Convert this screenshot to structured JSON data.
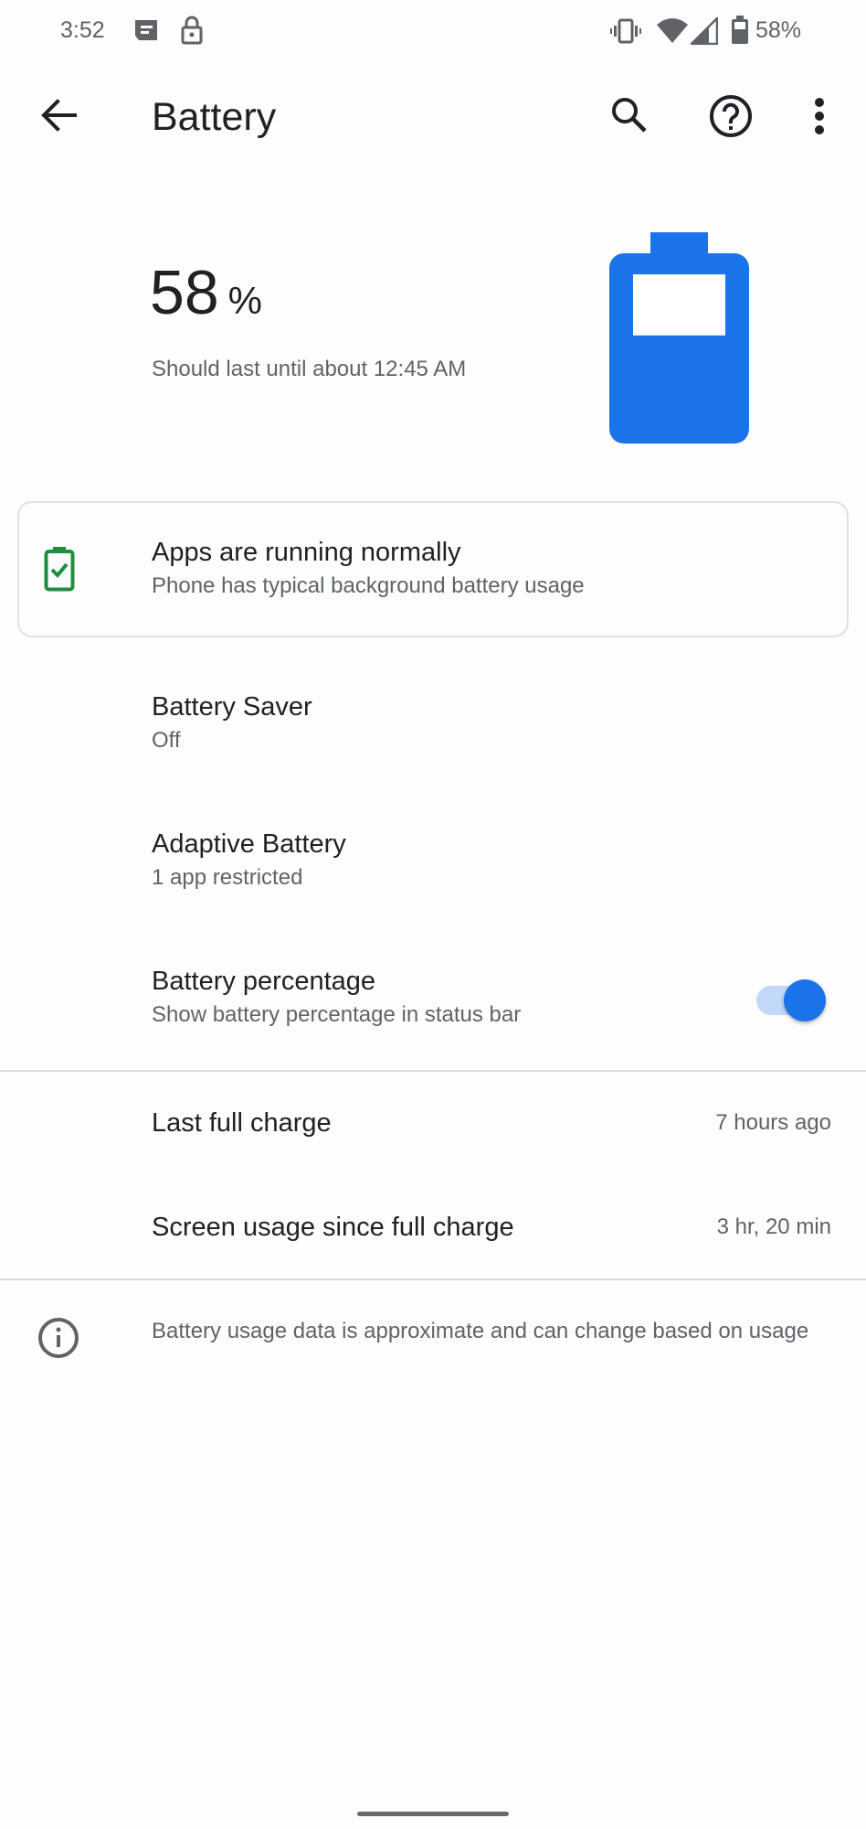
{
  "status_bar": {
    "time": "3:52",
    "left_icons": [
      "messages-notification-icon",
      "lock-icon"
    ],
    "right_icons": [
      "vibrate-icon",
      "wifi-icon",
      "cell-signal-icon",
      "battery-icon"
    ],
    "battery_percent_text": "58%"
  },
  "toolbar": {
    "back_icon": "arrow-back-icon",
    "title": "Battery",
    "actions": [
      {
        "name": "search",
        "icon": "search-icon"
      },
      {
        "name": "help",
        "icon": "help-icon"
      },
      {
        "name": "more",
        "icon": "more-vert-icon"
      }
    ]
  },
  "header": {
    "percent_value": "58",
    "percent_unit": "%",
    "level_fraction": 0.58,
    "estimate": "Should last until about 12:45 AM",
    "accent_color": "#1A73E8"
  },
  "tip_card": {
    "icon": "battery-check-icon",
    "icon_color": "#1E8E3E",
    "title": "Apps are running normally",
    "subtitle": "Phone has typical background battery usage"
  },
  "settings": [
    {
      "title": "Battery Saver",
      "subtitle": "Off"
    },
    {
      "title": "Adaptive Battery",
      "subtitle": "1 app restricted"
    },
    {
      "title": "Battery percentage",
      "subtitle": "Show battery percentage in status bar",
      "toggle_on": true
    }
  ],
  "usage": [
    {
      "label": "Last full charge",
      "value": "7 hours ago"
    },
    {
      "label": "Screen usage since full charge",
      "value": "3 hr, 20 min"
    }
  ],
  "footer": {
    "icon": "info-icon",
    "text": "Battery usage data is approximate and can change based on usage"
  }
}
